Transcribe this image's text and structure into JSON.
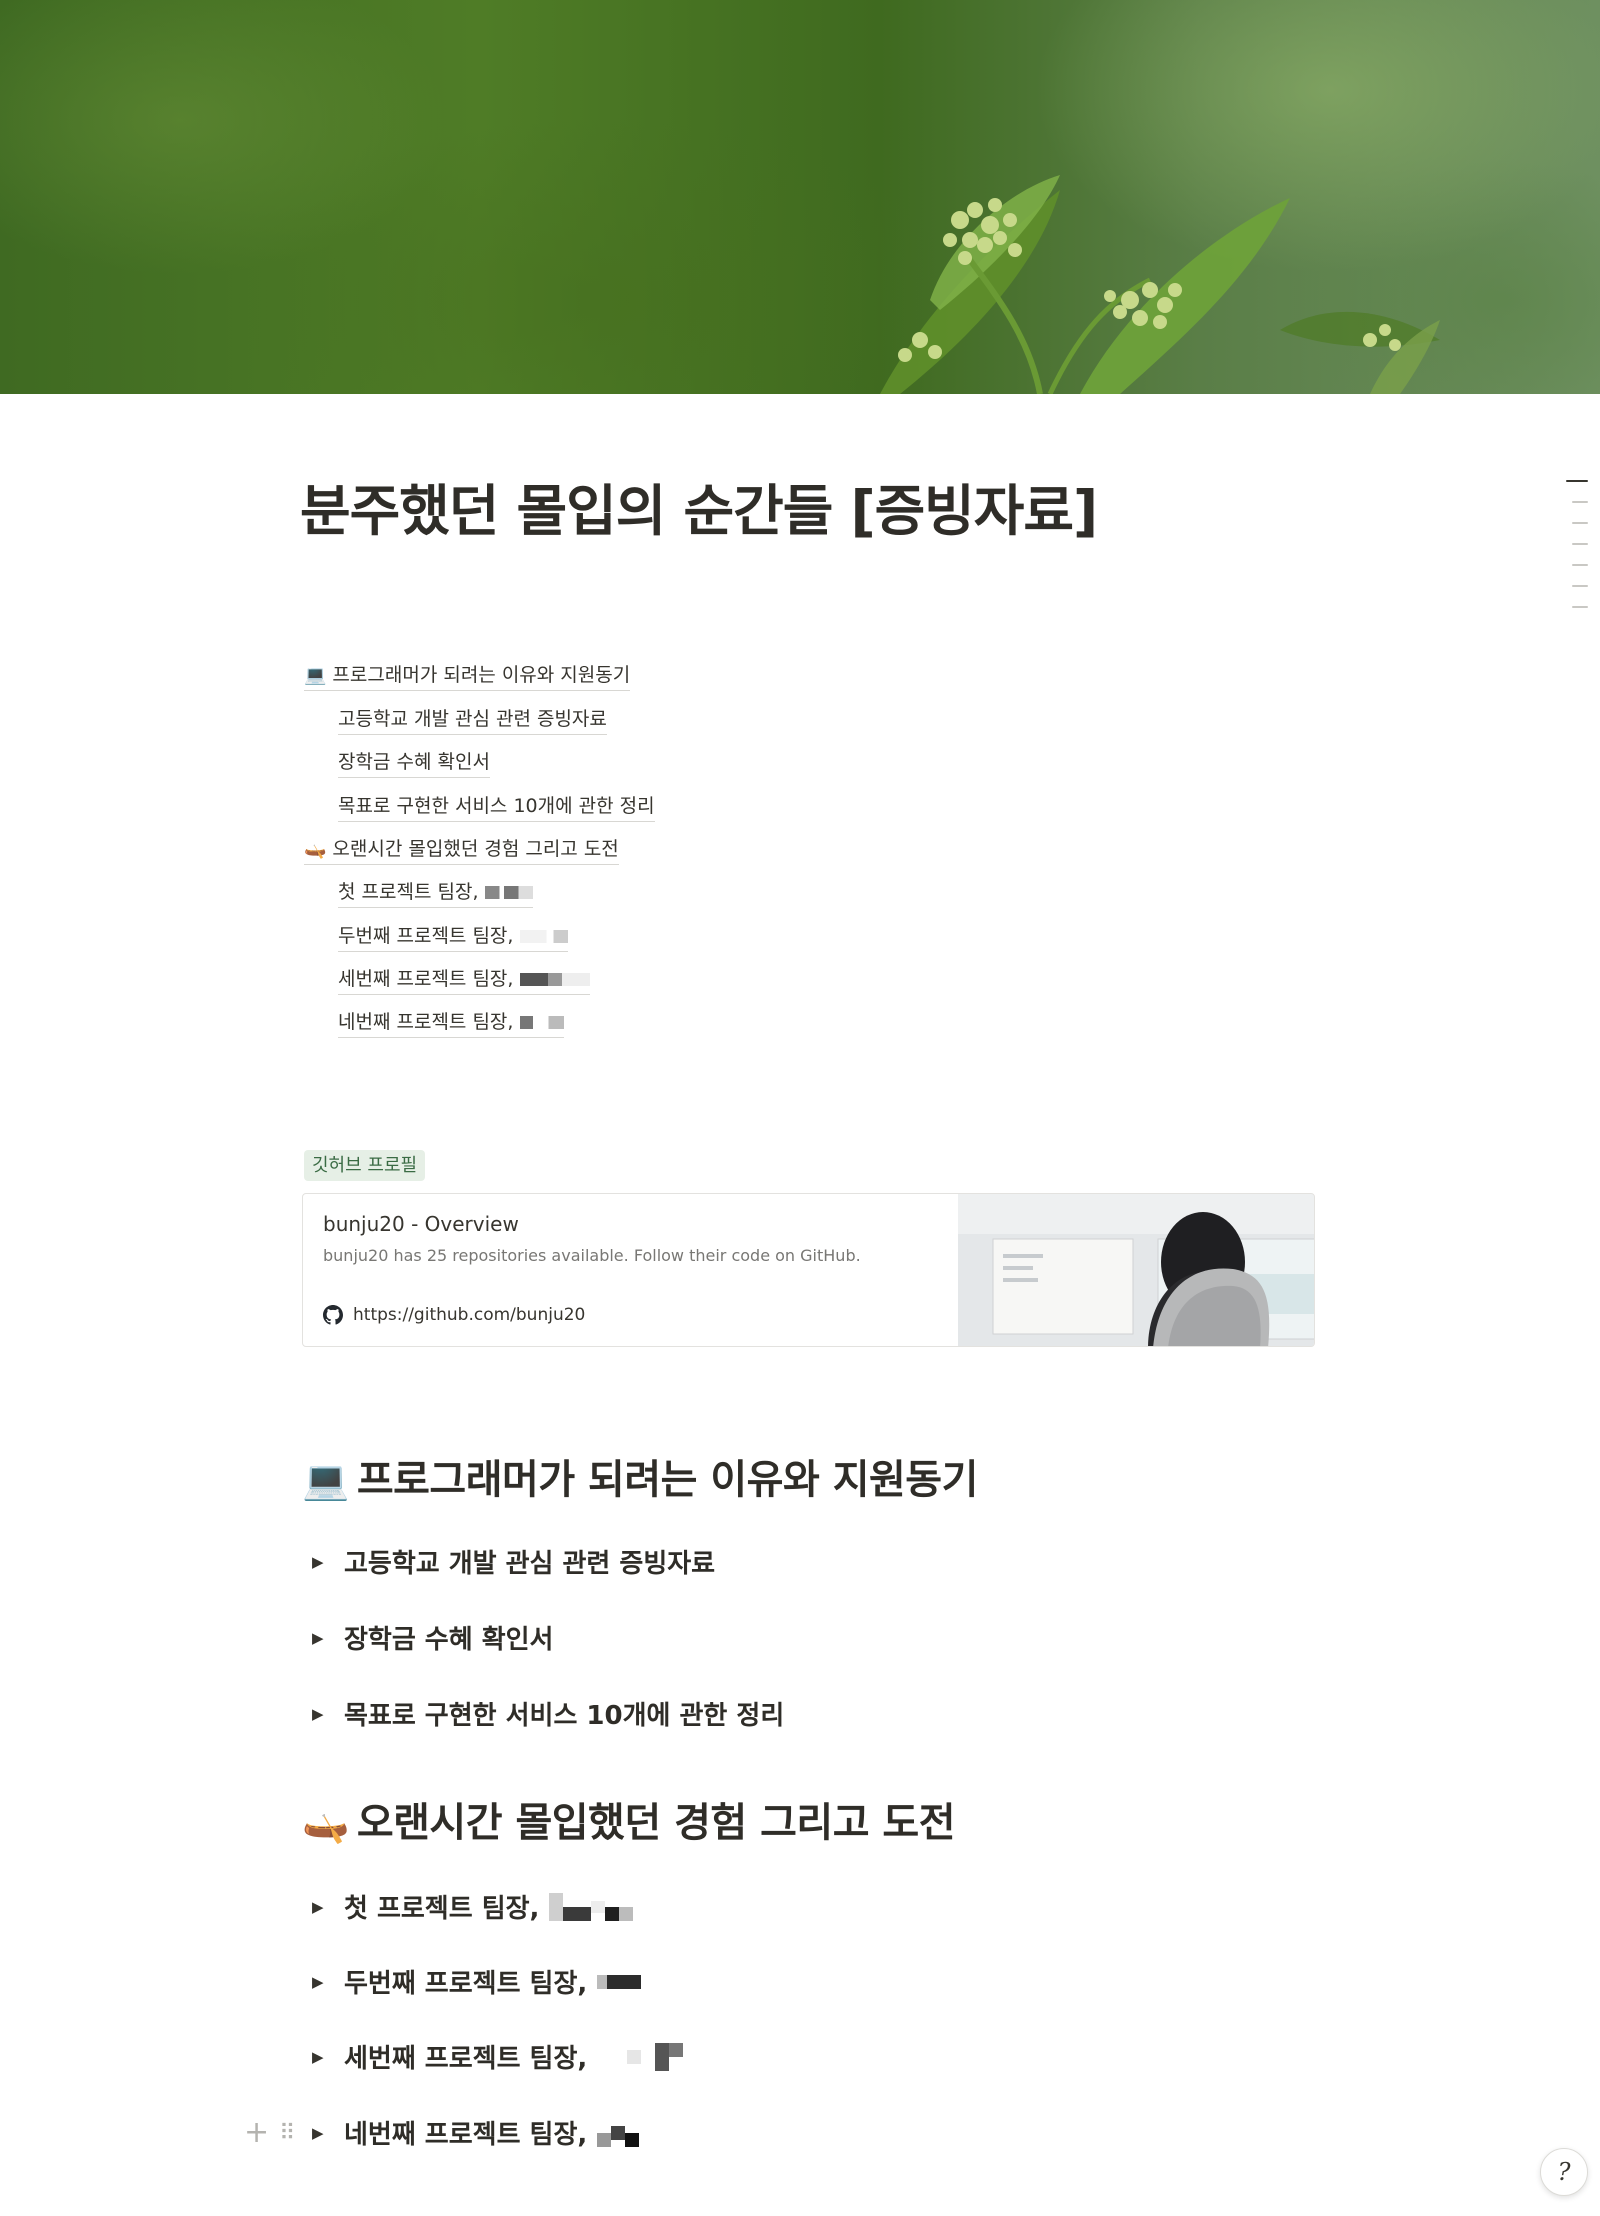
{
  "page": {
    "title": "분주했던 몰입의 순간들 [증빙자료]"
  },
  "toc": [
    {
      "label": "프로그래머가 되려는 이유와 지원동기",
      "icon": "laptop-emoji"
    },
    {
      "label": "고등학교 개발 관심 관련 증빙자료"
    },
    {
      "label": "장학금 수혜 확인서"
    },
    {
      "label": "목표로 구현한 서비스 10개에 관한 정리"
    },
    {
      "label": "오랜시간 몰입했던 경험 그리고 도전",
      "icon": "canoe-emoji"
    },
    {
      "label": "첫 프로젝트 팀장,"
    },
    {
      "label": "두번째 프로젝트 팀장,"
    },
    {
      "label": "세번째 프로젝트 팀장,"
    },
    {
      "label": "네번째 프로젝트 팀장,"
    }
  ],
  "tag": {
    "label": "깃허브 프로필",
    "color": "#3a6b44"
  },
  "bookmark": {
    "title": "bunju20 - Overview",
    "description": "bunju20 has 25 repositories available. Follow their code on GitHub.",
    "url": "https://github.com/bunju20",
    "icon": "github-icon"
  },
  "sections": [
    {
      "heading": "프로그래머가 되려는 이유와 지원동기",
      "icon": "laptop-emoji",
      "toggles": [
        {
          "label": "고등학교 개발 관심 관련 증빙자료"
        },
        {
          "label": "장학금 수혜 확인서"
        },
        {
          "label": "목표로 구현한 서비스 10개에 관한 정리"
        }
      ]
    },
    {
      "heading": "오랜시간 몰입했던 경험 그리고 도전",
      "icon": "canoe-emoji",
      "toggles": [
        {
          "label": "첫 프로젝트 팀장,"
        },
        {
          "label": "두번째 프로젝트 팀장,"
        },
        {
          "label": "세번째 프로젝트 팀장,"
        },
        {
          "label": "네번째 프로젝트 팀장,"
        }
      ]
    }
  ],
  "icons": {
    "toggle": "triangle-right-icon",
    "add": "plus-icon",
    "drag": "drag-handle-icon",
    "help": "help-icon"
  }
}
